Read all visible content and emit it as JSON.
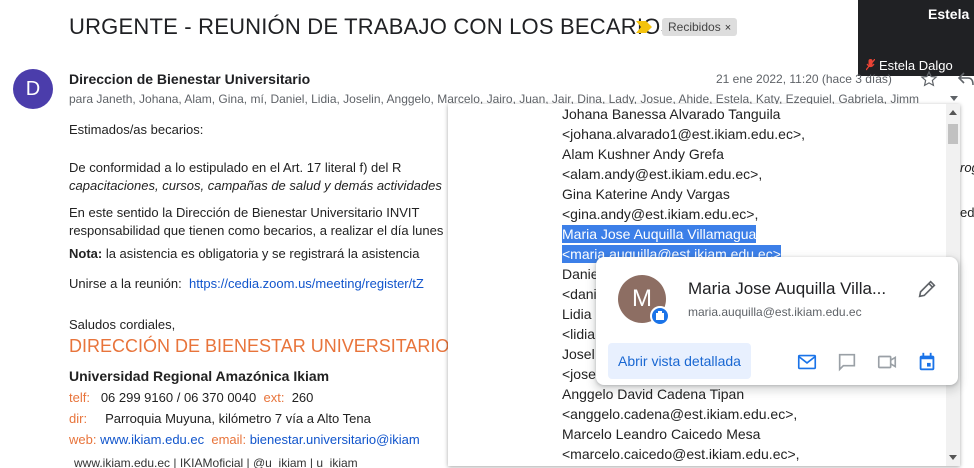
{
  "email": {
    "subject": "URGENTE - REUNIÓN DE TRABAJO CON LOS BECARIOS",
    "label": "Recibidos",
    "label_close": "×",
    "sender_initial": "D",
    "sender_name": "Direccion de Bienestar Universitario",
    "date": "21 ene 2022, 11:20 (hace 3 días)",
    "recipients": "para Janeth, Johana, Alam, Gina, mí, Daniel, Lidia, Joselin, Anggelo, Marcelo, Jairo, Juan, Jair, Dina, Lady, Josue, Ahide, Estela, Katy, Ezequiel, Gabriela, Jimm"
  },
  "video": {
    "tile_name": "Estela",
    "caption": "Estela Dalgo"
  },
  "body": {
    "greeting": "Estimados/as becarios:",
    "p1_line1": "De conformidad a lo estipulado en el Art. 17 literal f) del R",
    "p1_line1_end": "rog",
    "p1_line2": "capacitaciones, cursos, campañas de salud y demás actividades",
    "p2_line1": "En este sentido la Dirección de Bienestar Universitario INVIT",
    "p2_line1_end": "ed",
    "p2_line2": "responsabilidad que tienen como becarios, a realizar el día lunes",
    "note_label": "Nota:",
    "note_text": " la asistencia es obligatoria y se registrará la asistencia",
    "join_label": "Unirse a la reunión:",
    "join_link": "https://cedia.zoom.us/meeting/register/tZ",
    "closing": "Saludos cordiales,"
  },
  "signature": {
    "title": "DIRECCIÓN DE BIENESTAR UNIVERSITARIO",
    "org": "Universidad Regional Amazónica Ikiam",
    "telf_label": "telf:",
    "telf": "06 299 9160 / 06 370 0040",
    "ext_label": "ext:",
    "ext": "260",
    "dir_label": "dir:",
    "dir": "Parroquia Muyuna, kilómetro 7 vía a Alto Tena",
    "web_label": "web:",
    "web": "www.ikiam.edu.ec",
    "email_label": "email:",
    "email": "bienestar.universitario@ikiam",
    "footer_web": "www.ikiam.edu.ec",
    "footer_fb": "IKIAMoficial",
    "footer_tw": "@u_ikiam",
    "footer_ig": "u_ikiam"
  },
  "recipient_list": [
    {
      "text": "Johana Banessa Alvarado Tanguila",
      "highlight": false
    },
    {
      "text": "<johana.alvarado1@est.ikiam.edu.ec>,",
      "highlight": false
    },
    {
      "text": "Alam Kushner Andy Grefa",
      "highlight": false
    },
    {
      "text": "<alam.andy@est.ikiam.edu.ec>,",
      "highlight": false
    },
    {
      "text": "Gina Katerine Andy Vargas",
      "highlight": false
    },
    {
      "text": "<gina.andy@est.ikiam.edu.ec>,",
      "highlight": false
    },
    {
      "text": "Maria Jose Auquilla Villamagua",
      "highlight": true
    },
    {
      "text": "<maria.auquilla@est.ikiam.edu.ec>",
      "highlight": true
    },
    {
      "text": "Danie",
      "highlight": false
    },
    {
      "text": "<dani",
      "highlight": false
    },
    {
      "text": "Lidia",
      "highlight": false
    },
    {
      "text": "<lidia",
      "highlight": false
    },
    {
      "text": "Josel",
      "highlight": false
    },
    {
      "text": "<jose",
      "highlight": false
    },
    {
      "text": "Anggelo David Cadena Tipan",
      "highlight": false
    },
    {
      "text": "<anggelo.cadena@est.ikiam.edu.ec>,",
      "highlight": false
    },
    {
      "text": "Marcelo Leandro Caicedo Mesa",
      "highlight": false
    },
    {
      "text": "<marcelo.caicedo@est.ikiam.edu.ec>,",
      "highlight": false
    }
  ],
  "contact_card": {
    "initial": "M",
    "name": "Maria Jose Auquilla Villa...",
    "email": "maria.auquilla@est.ikiam.edu.ec",
    "detail_button": "Abrir vista detallada",
    "accent": "#1a73e8"
  },
  "icons": [
    "label-arrow-icon",
    "star-icon",
    "reply-icon",
    "edit-icon",
    "mail-icon",
    "chat-icon",
    "video-icon",
    "calendar-icon",
    "muted-mic-icon"
  ]
}
